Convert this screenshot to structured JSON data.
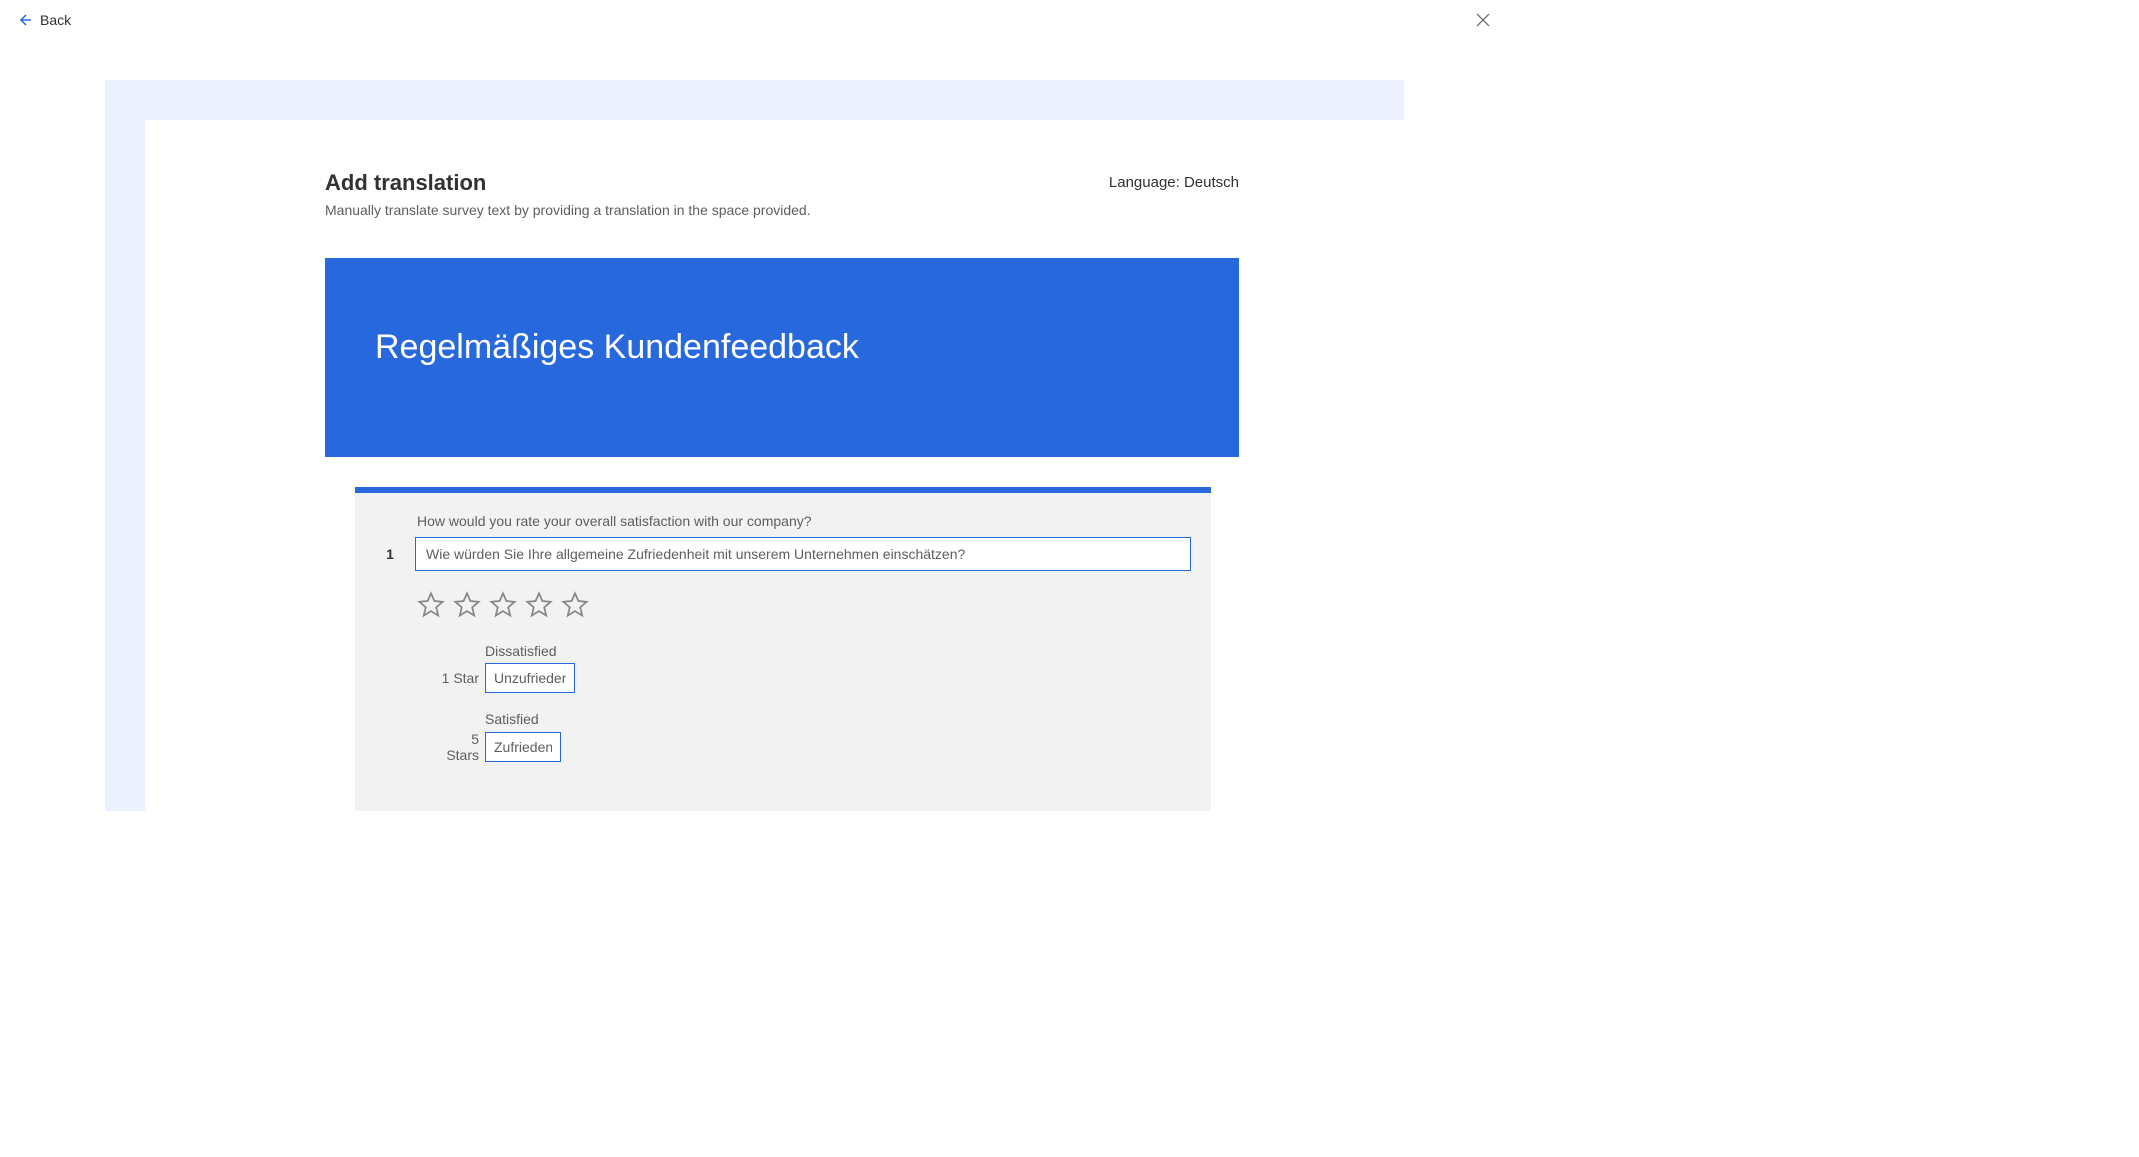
{
  "topbar": {
    "back_label": "Back"
  },
  "header": {
    "title": "Add translation",
    "subtitle": "Manually translate survey text by providing a translation in the space provided.",
    "language_label": "Language: Deutsch"
  },
  "banner": {
    "title": "Regelmäßiges Kundenfeedback"
  },
  "question": {
    "number": "1",
    "source_text": "How would you rate your overall satisfaction with our company?",
    "translation_value": "Wie würden Sie Ihre allgemeine Zufriedenheit mit unserem Unternehmen einschätzen?",
    "rating_low": {
      "source_label": "Dissatisfied",
      "prefix": "1 Star",
      "translation_value": "Unzufrieden"
    },
    "rating_high": {
      "source_label": "Satisfied",
      "prefix": "5 Stars",
      "translation_value": "Zufrieden"
    }
  }
}
